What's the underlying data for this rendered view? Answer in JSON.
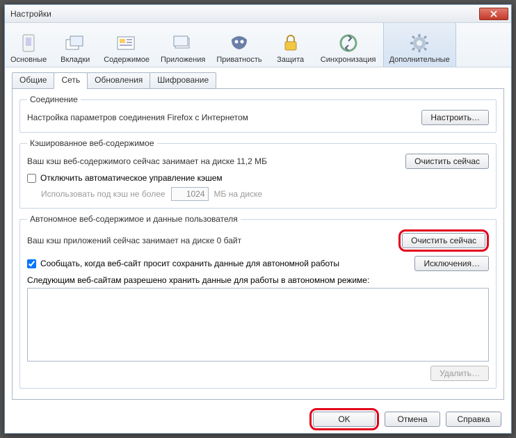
{
  "title": "Настройки",
  "toolbar": [
    {
      "key": "main",
      "label": "Основные"
    },
    {
      "key": "tabs",
      "label": "Вкладки"
    },
    {
      "key": "content",
      "label": "Содержимое"
    },
    {
      "key": "apps",
      "label": "Приложения"
    },
    {
      "key": "privacy",
      "label": "Приватность"
    },
    {
      "key": "security",
      "label": "Защита"
    },
    {
      "key": "sync",
      "label": "Синхронизация"
    },
    {
      "key": "advanced",
      "label": "Дополнительные"
    }
  ],
  "tabs": [
    {
      "label": "Общие"
    },
    {
      "label": "Сеть"
    },
    {
      "label": "Обновления"
    },
    {
      "label": "Шифрование"
    }
  ],
  "connection": {
    "legend": "Соединение",
    "desc": "Настройка параметров соединения Firefox с Интернетом",
    "configure": "Настроить…"
  },
  "cache": {
    "legend": "Кэшированное веб-содержимое",
    "desc": "Ваш кэш веб-содержимого сейчас занимает на диске 11,2 МБ",
    "clear": "Очистить сейчас",
    "disable_auto": "Отключить автоматическое управление кэшем",
    "limit_label": "Использовать под кэш не более",
    "limit_value": "1024",
    "limit_unit": "МБ на диске"
  },
  "offline": {
    "legend": "Автономное веб-содержимое и данные пользователя",
    "desc": "Ваш кэш приложений сейчас занимает на диске 0 байт",
    "clear": "Очистить сейчас",
    "notify": "Сообщать, когда веб-сайт просит сохранить данные для автономной работы",
    "exceptions": "Исключения…",
    "sites_label": "Следующим веб-сайтам разрешено хранить данные для работы в автономном режиме:",
    "remove": "Удалить…"
  },
  "buttons": {
    "ok": "OK",
    "cancel": "Отмена",
    "help": "Справка"
  }
}
